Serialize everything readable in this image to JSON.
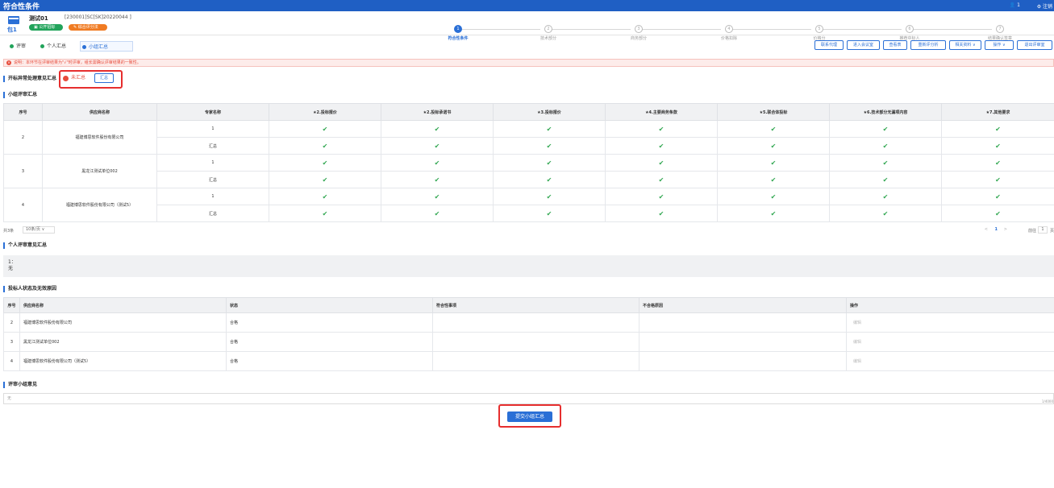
{
  "window": {
    "title": "符合性条件",
    "user": "1",
    "logout": "注销"
  },
  "project": {
    "package_label": "包1",
    "name": "测试01",
    "code": "[230001]SC[SK]20220044 ]",
    "tags": [
      "公开招标",
      "综合评分法"
    ]
  },
  "steps": [
    {
      "num": "1",
      "label": "符合性条件",
      "active": true
    },
    {
      "num": "2",
      "label": "技术部分",
      "active": false
    },
    {
      "num": "3",
      "label": "商务部分",
      "active": false
    },
    {
      "num": "4",
      "label": "价格扣除",
      "active": false
    },
    {
      "num": "5",
      "label": "价格分",
      "active": false
    },
    {
      "num": "6",
      "label": "推荐中标人",
      "active": false
    },
    {
      "num": "7",
      "label": "结果确认签章",
      "active": false
    }
  ],
  "tabs": [
    "评审",
    "个人汇总",
    "小组汇总"
  ],
  "toolbar": [
    "联系代理",
    "进入会议室",
    "查看表",
    "重新评分析",
    "相关资料 ∨",
    "操作 ∨",
    "退出评审室"
  ],
  "alert": "说明：本环节在评审结果为\"√\"时评审，组长需确认评审结果的一致性。",
  "exception": {
    "title": "开标异常处理意见汇总",
    "status": "未汇总",
    "button": "汇总"
  },
  "group_summary": {
    "title": "小组评审汇总",
    "headers": [
      "序号",
      "供应商名称",
      "专家名称",
      "★2.投标报价",
      "★2.投标承诺书",
      "★3.投标报价",
      "★4.主要商务条款",
      "★5.联合体投标",
      "★6.技术部分无漏项内容",
      "★7.其他要求"
    ],
    "rows": [
      {
        "no": "2",
        "supplier": "福建博思软件股份有限公司",
        "expert": "1",
        "total": "汇总"
      },
      {
        "no": "3",
        "supplier": "黑龙江测试单位002",
        "expert": "1",
        "total": "汇总"
      },
      {
        "no": "4",
        "supplier": "福建博思软件股份有限公司（测试5）",
        "expert": "1",
        "total": "汇总"
      }
    ],
    "check_glyph": "✔"
  },
  "pager": {
    "total": "共3条",
    "page_size": "10条/页 ∨",
    "prev": "<",
    "page": "1",
    "next": ">",
    "goto": "前往",
    "jump_value": "1",
    "unit": "页"
  },
  "personal": {
    "title": "个人评审意见汇总",
    "line1": "1：",
    "line2": "无"
  },
  "bidders": {
    "title": "投标人状态及无效原因",
    "headers": [
      "序号",
      "供应商名称",
      "状态",
      "符合性事项",
      "不合格原因",
      "操作"
    ],
    "rows": [
      {
        "no": "2",
        "supplier": "福建博思软件股份有限公司",
        "status": "合格",
        "matter": "",
        "reason": "",
        "op": "编辑"
      },
      {
        "no": "3",
        "supplier": "黑龙江测试单位002",
        "status": "合格",
        "matter": "",
        "reason": "",
        "op": "编辑"
      },
      {
        "no": "4",
        "supplier": "福建博思软件股份有限公司（测试5）",
        "status": "合格",
        "matter": "",
        "reason": "",
        "op": "编辑"
      }
    ]
  },
  "remark": {
    "title": "评审小组意见",
    "value": "无",
    "count": "1/4000"
  },
  "submit_label": "提交小组汇总"
}
